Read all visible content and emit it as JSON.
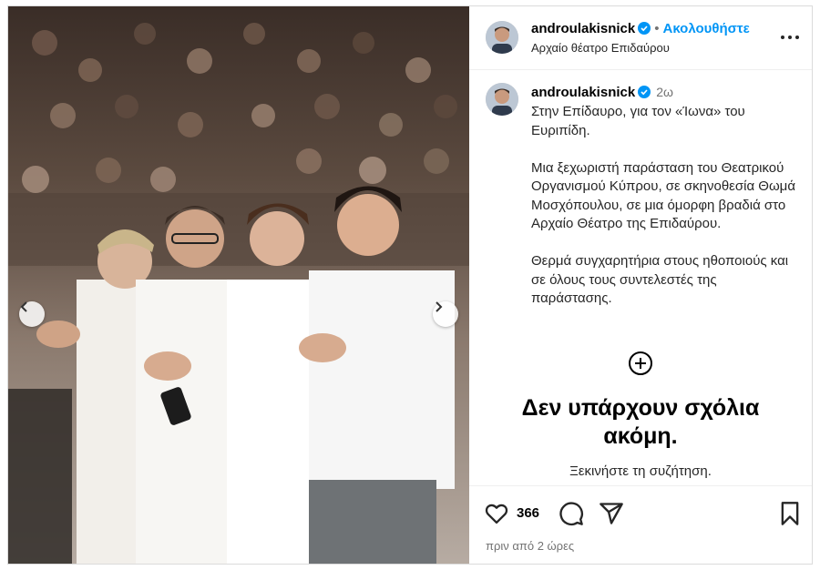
{
  "post": {
    "username": "androulakisnick",
    "follow_label": "Ακολουθήστε",
    "location": "Αρχαίο θέατρο Επιδαύρου",
    "time_short": "2ω",
    "caption": "Στην Επίδαυρο, για τον «Ίωνα» του Ευριπίδη.\n\nΜια ξεχωριστή παράσταση του Θεατρικού Οργανισμού Κύπρου, σε σκηνοθεσία Θωμά Μοσχόπουλου, σε μια όμορφη βραδιά στο Αρχαίο Θέατρο της Επιδαύρου.\n\nΘερμά συγχαρητήρια στους ηθοποιούς και σε όλους τους συντελεστές της παράστασης.",
    "no_comments_title": "Δεν υπάρχουν σχόλια ακόμη.",
    "no_comments_sub": "Ξεκινήστε τη συζήτηση.",
    "likes": "366",
    "posted_ago": "πριν από 2 ώρες"
  },
  "icons": {
    "verified": "verified-badge-icon",
    "more": "more-options-icon",
    "add_comment": "add-comment-icon",
    "like": "heart-icon",
    "comment": "comment-icon",
    "share": "share-icon",
    "save": "bookmark-icon",
    "prev": "chevron-left-icon",
    "next": "chevron-right-icon"
  },
  "colors": {
    "accent": "#0095f6",
    "verified": "#0095f6",
    "muted": "#737373"
  }
}
